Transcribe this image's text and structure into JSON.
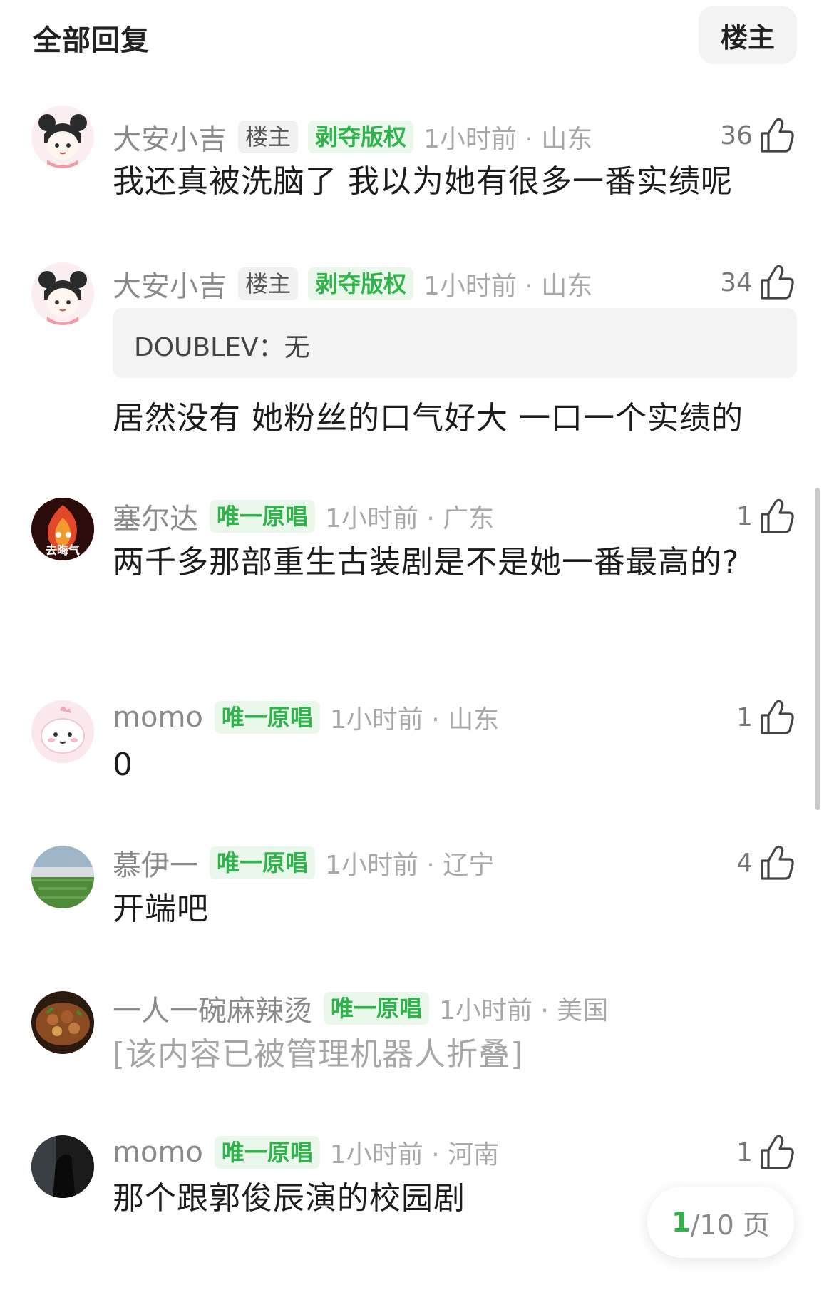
{
  "header": {
    "title": "全部回复",
    "op_filter_label": "楼主"
  },
  "comments": [
    {
      "name": "大安小吉",
      "badges": [
        "楼主",
        "剥夺版权"
      ],
      "time_location": "1小时前 · 山东",
      "likes": "36",
      "text": "我还真被洗脑了 我以为她有很多一番实绩呢"
    },
    {
      "name": "大安小吉",
      "badges": [
        "楼主",
        "剥夺版权"
      ],
      "time_location": "1小时前 · 山东",
      "likes": "34",
      "quote": "DOUBLEV：无",
      "text": "居然没有 她粉丝的口气好大 一口一个实绩的"
    },
    {
      "name": "塞尔达",
      "badges": [
        "唯一原唱"
      ],
      "time_location": "1小时前 · 广东",
      "likes": "1",
      "avatar_caption": "去晦气",
      "text": "两千多那部重生古装剧是不是她一番最高的?"
    },
    {
      "name": "momo",
      "badges": [
        "唯一原唱"
      ],
      "time_location": "1小时前 · 山东",
      "likes": "1",
      "text": "0"
    },
    {
      "name": "慕伊一",
      "badges": [
        "唯一原唱"
      ],
      "time_location": "1小时前 · 辽宁",
      "likes": "4",
      "text": "开端吧"
    },
    {
      "name": "一人一碗麻辣烫",
      "badges": [
        "唯一原唱"
      ],
      "time_location": "1小时前 · 美国",
      "text": "[该内容已被管理机器人折叠]"
    },
    {
      "name": "momo",
      "badges": [
        "唯一原唱"
      ],
      "time_location": "1小时前 · 河南",
      "likes": "1",
      "text": "那个跟郭俊辰演的校园剧"
    }
  ],
  "pager": {
    "current": "1",
    "total": "/10 页"
  },
  "colors": {
    "accent_green": "#2fb34a",
    "meta_gray": "#a8a8a8"
  }
}
